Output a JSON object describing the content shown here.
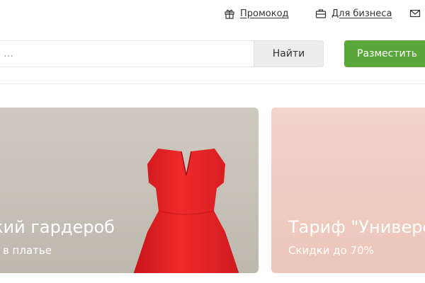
{
  "topbar": {
    "promo_label": "Промокод",
    "business_label": "Для бизнеса"
  },
  "search": {
    "placeholder": "…",
    "find_label": "Найти"
  },
  "place_button_label": "Разместить",
  "banners": [
    {
      "title": "кий гардероб",
      "subtitle": "о в платье"
    },
    {
      "title": "Тариф \"Универсальный\"",
      "subtitle": "Скидки до 70%"
    }
  ],
  "colors": {
    "accent_green": "#5aa73b",
    "text": "#333333"
  },
  "icons": {
    "promo": "gift-icon",
    "business": "briefcase-icon",
    "mail": "envelope-icon"
  }
}
